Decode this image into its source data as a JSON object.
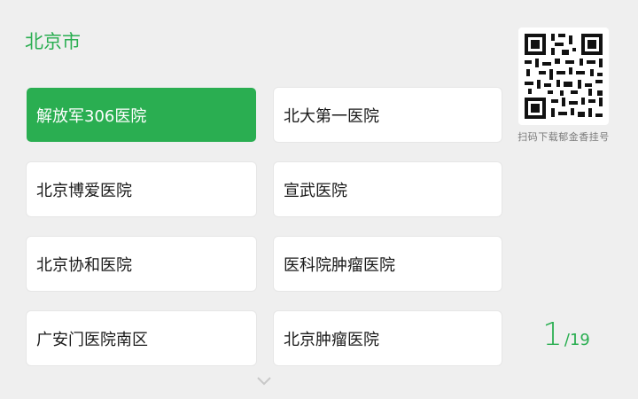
{
  "city": {
    "title": "北京市"
  },
  "hospitals": [
    {
      "label": "解放军306医院",
      "selected": true
    },
    {
      "label": "北大第一医院",
      "selected": false
    },
    {
      "label": "北京博爱医院",
      "selected": false
    },
    {
      "label": "宣武医院",
      "selected": false
    },
    {
      "label": "北京协和医院",
      "selected": false
    },
    {
      "label": "医科院肿瘤医院",
      "selected": false
    },
    {
      "label": "广安门医院南区",
      "selected": false
    },
    {
      "label": "北京肿瘤医院",
      "selected": false
    }
  ],
  "qr": {
    "caption": "扫码下载郁金香挂号",
    "icon": "qr-code-icon"
  },
  "pager": {
    "current": "1",
    "separator": "/",
    "total": "19"
  },
  "icons": {
    "more": "chevron-down-icon"
  },
  "colors": {
    "accent": "#2aae51",
    "background": "#efefef",
    "card": "#ffffff"
  }
}
